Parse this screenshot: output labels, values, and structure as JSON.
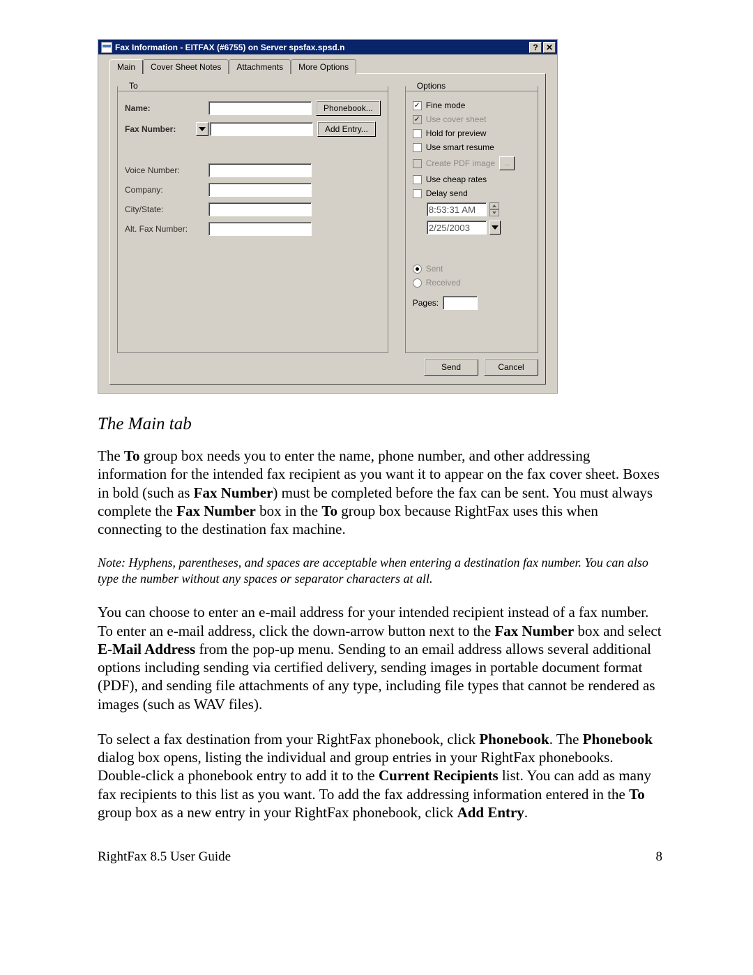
{
  "dialog": {
    "title": "Fax Information - EITFAX (#6755) on Server spsfax.spsd.n",
    "help_glyph": "?",
    "close_glyph": "✕",
    "tabs": [
      "Main",
      "Cover Sheet Notes",
      "Attachments",
      "More Options"
    ],
    "to": {
      "legend": "To",
      "name_label": "Name:",
      "fax_label": "Fax Number:",
      "voice_label": "Voice Number:",
      "company_label": "Company:",
      "citystate_label": "City/State:",
      "altfax_label": "Alt. Fax Number:",
      "phonebook_btn": "Phonebook...",
      "addentry_btn": "Add Entry..."
    },
    "options": {
      "legend": "Options",
      "fine_mode": "Fine mode",
      "use_cover": "Use cover sheet",
      "hold_preview": "Hold for preview",
      "smart_resume": "Use smart resume",
      "create_pdf": "Create PDF image",
      "cheap_rates": "Use cheap rates",
      "delay_send": "Delay send",
      "time_val": "8:53:31 AM",
      "date_val": "2/25/2003",
      "sent": "Sent",
      "received": "Received",
      "pages_label": "Pages:"
    },
    "footer": {
      "send": "Send",
      "cancel": "Cancel"
    }
  },
  "doc": {
    "subheading": "The Main tab",
    "p1_a": "The ",
    "p1_b": "To",
    "p1_c": " group box needs you to enter the name, phone number, and other addressing information for the intended fax recipient as you want it to appear on the fax cover sheet. Boxes in bold (such as ",
    "p1_d": "Fax Number",
    "p1_e": ") must be completed before the fax can be sent. You must always complete the ",
    "p1_f": "Fax Number",
    "p1_g": " box in the ",
    "p1_h": "To",
    "p1_i": " group box because RightFax uses this when connecting to the destination fax machine.",
    "note": "Note: Hyphens, parentheses, and spaces are acceptable when entering a destination fax number. You can also type the number without any spaces or separator characters at all.",
    "p2_a": "You can choose to enter an e-mail address for your intended recipient instead of a fax number. To enter an e-mail address, click the down-arrow button next to the ",
    "p2_b": "Fax Number",
    "p2_c": " box and select ",
    "p2_d": "E-Mail Address",
    "p2_e": " from the pop-up menu. Sending to an email address allows several additional options including sending via certified delivery, sending images in portable document format (PDF), and sending file attachments of any type, including file types that cannot be rendered as images (such as WAV files).",
    "p3_a": "To select a fax destination from your RightFax phonebook, click ",
    "p3_b": "Phonebook",
    "p3_c": ". The ",
    "p3_d": "Phonebook",
    "p3_e": " dialog box opens, listing the individual and group entries in your RightFax phonebooks. Double-click a phonebook entry to add it to the ",
    "p3_f": "Current Recipients",
    "p3_g": " list. You can add as many fax recipients to this list as you want. To add the fax addressing information entered in the ",
    "p3_h": "To",
    "p3_i": " group box as a new entry in your RightFax phonebook, click ",
    "p3_j": "Add Entry",
    "p3_k": ".",
    "footer_left": "RightFax 8.5 User Guide",
    "footer_right": "8"
  }
}
